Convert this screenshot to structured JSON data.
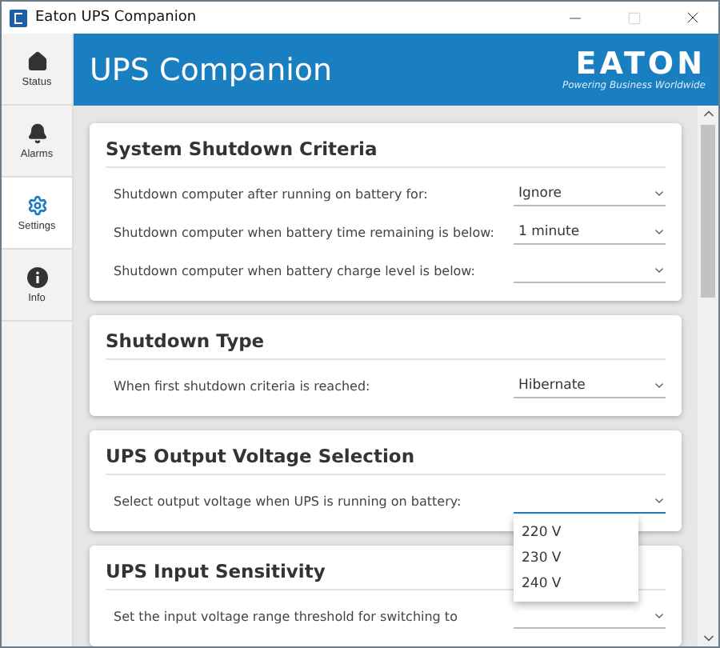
{
  "window": {
    "title": "Eaton UPS Companion"
  },
  "sidebar": {
    "items": [
      {
        "kind": "status",
        "label": "Status",
        "selected": false
      },
      {
        "kind": "alarms",
        "label": "Alarms",
        "selected": false
      },
      {
        "kind": "settings",
        "label": "Settings",
        "selected": true
      },
      {
        "kind": "info",
        "label": "Info",
        "selected": false
      }
    ]
  },
  "header": {
    "title": "UPS Companion",
    "logo": "EATON",
    "tagline": "Powering Business Worldwide"
  },
  "cards": [
    {
      "title": "System Shutdown Criteria",
      "rows": [
        {
          "label": "Shutdown computer after running on battery for:",
          "value": "Ignore",
          "focused": false
        },
        {
          "label": "Shutdown computer when battery time remaining is below:",
          "value": "1 minute",
          "focused": false
        },
        {
          "label": "Shutdown computer when battery charge level is below:",
          "focused": false
        }
      ]
    },
    {
      "title": "Shutdown Type",
      "rows": [
        {
          "label": "When first shutdown criteria is reached:",
          "value": "Hibernate",
          "focused": false
        }
      ]
    },
    {
      "title": "UPS Output Voltage Selection",
      "rows": [
        {
          "label": "Select output voltage when UPS is running on battery:",
          "focused": true,
          "options": [
            "220 V",
            "230 V",
            "240 V"
          ]
        }
      ]
    },
    {
      "title": "UPS Input Sensitivity",
      "rows": [
        {
          "label": "Set the input voltage range threshold for switching to",
          "focused": false
        }
      ]
    }
  ]
}
